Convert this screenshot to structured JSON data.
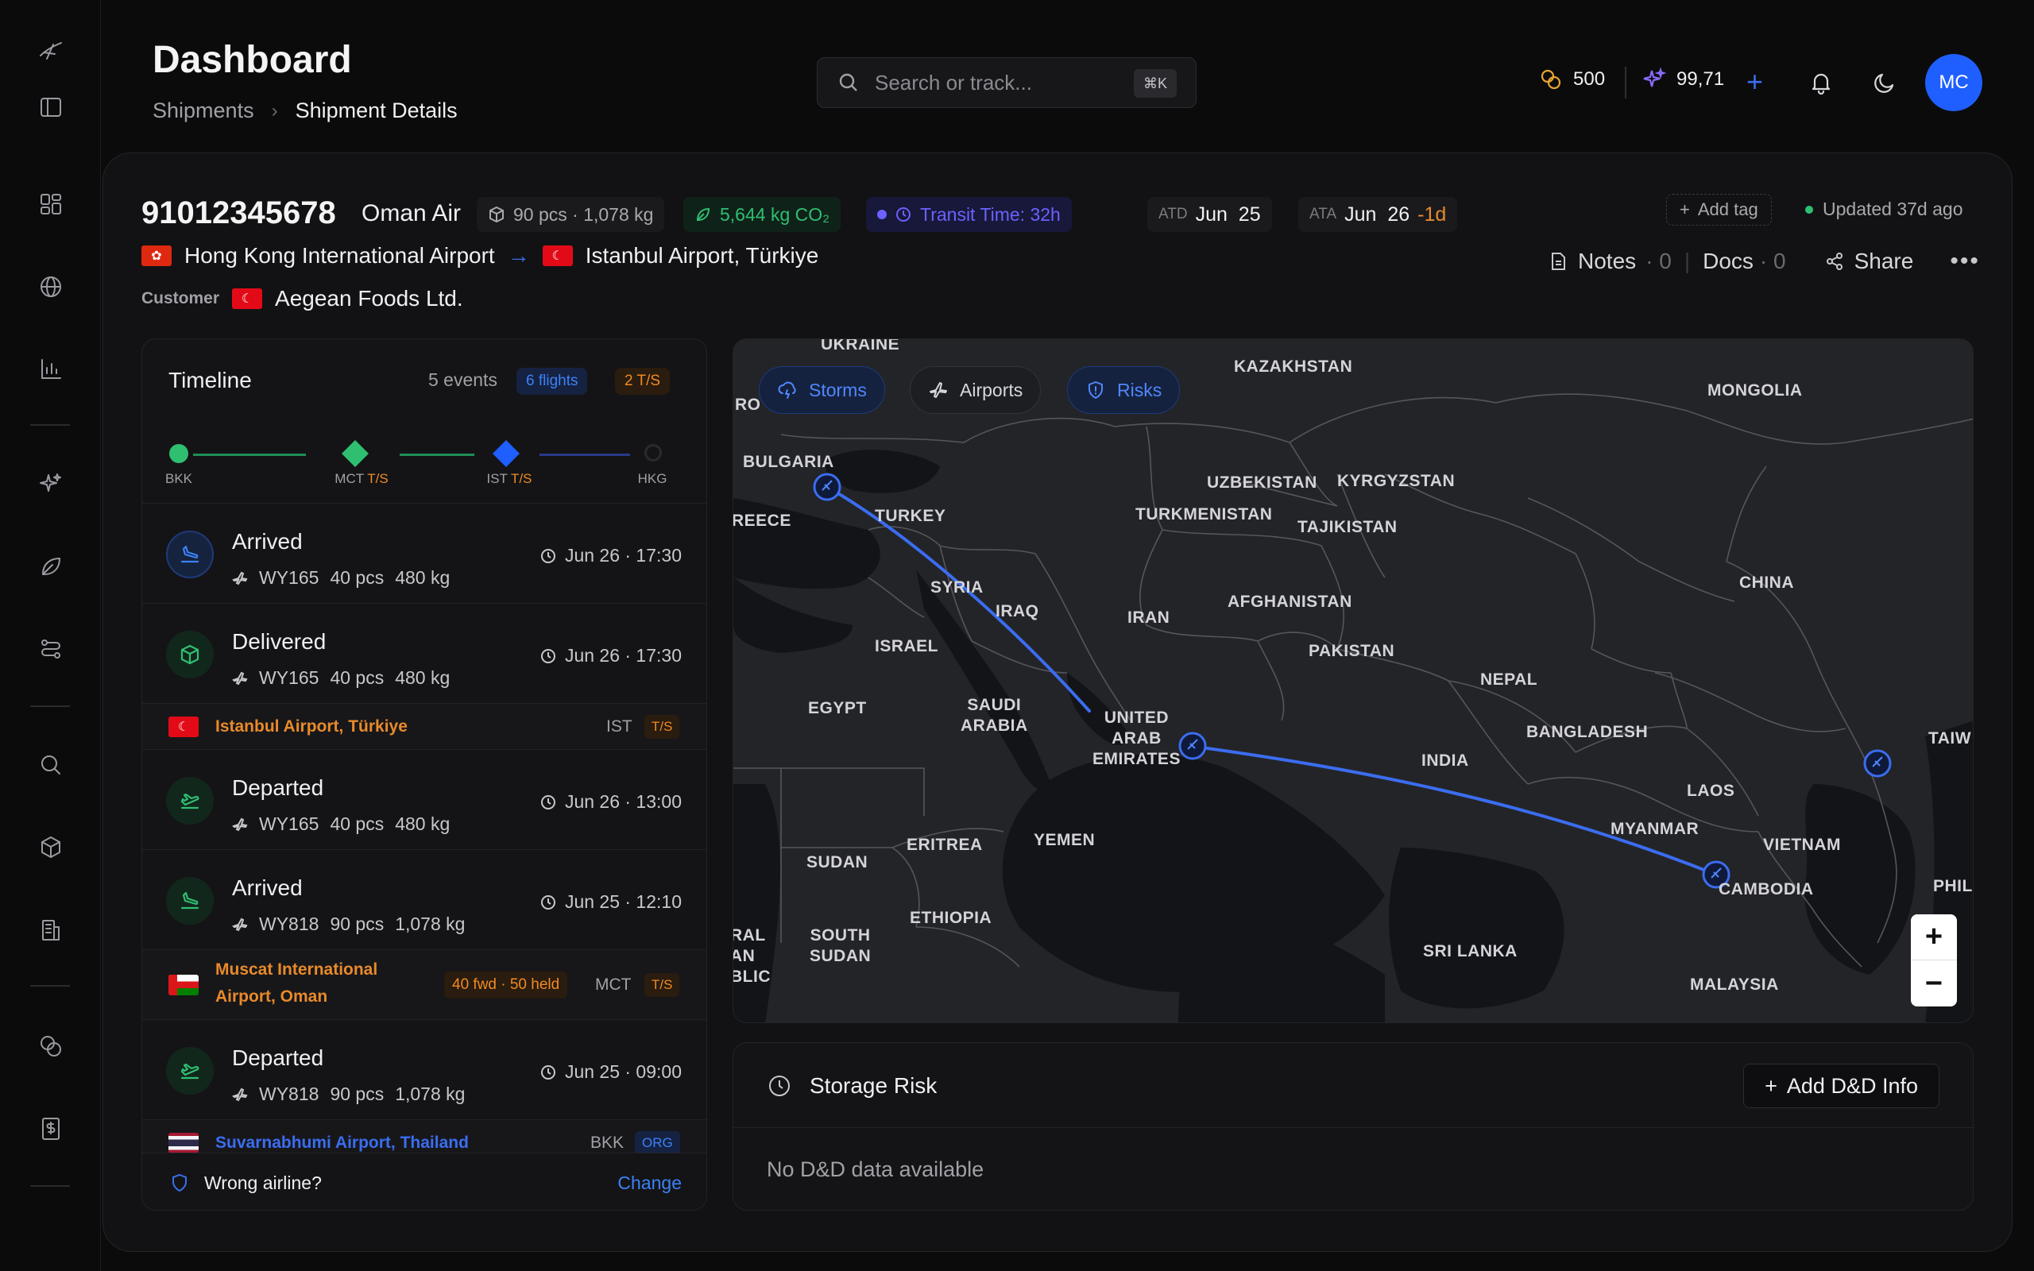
{
  "header": {
    "title": "Dashboard",
    "breadcrumbs": [
      "Shipments",
      "Shipment Details"
    ],
    "search_placeholder": "Search or track...",
    "search_shortcut": "⌘K",
    "credits_value": "500",
    "points_value": "99,71"
  },
  "avatar_initials": "MC",
  "shipment": {
    "id": "91012345678",
    "airline": "Oman Air",
    "pcs_weight": "90 pcs · 1,078 kg",
    "co2": "5,644 kg CO₂",
    "transit": "Transit Time: 32h",
    "atd_label": "ATD",
    "atd_value": "Jun  25",
    "ata_label": "ATA",
    "ata_value": "Jun  26",
    "ata_delay": "-1d",
    "add_tag": "Add tag",
    "updated": "Updated 37d ago",
    "origin": "Hong Kong International Airport",
    "destination": "Istanbul Airport, Türkiye",
    "customer_label": "Customer",
    "customer_name": "Aegean Foods Ltd.",
    "notes_label": "Notes",
    "notes_count": "· 0",
    "docs_label": "Docs",
    "docs_count": "· 0",
    "share_label": "Share"
  },
  "timeline": {
    "title": "Timeline",
    "events_count": "5 events",
    "flights_badge": "6 flights",
    "ts_badge": "2 T/S",
    "stops": [
      {
        "code": "BKK",
        "ts": ""
      },
      {
        "code": "MCT",
        "ts": "T/S"
      },
      {
        "code": "IST",
        "ts": "T/S"
      },
      {
        "code": "HKG",
        "ts": ""
      }
    ],
    "events": [
      {
        "title": "Arrived",
        "flight": "WY165",
        "pcs": "40 pcs",
        "kg": "480 kg",
        "time": "Jun 26 · 17:30"
      },
      {
        "title": "Delivered",
        "flight": "WY165",
        "pcs": "40 pcs",
        "kg": "480 kg",
        "time": "Jun 26 · 17:30"
      },
      {
        "title": "Departed",
        "flight": "WY165",
        "pcs": "40 pcs",
        "kg": "480 kg",
        "time": "Jun 26 · 13:00"
      },
      {
        "title": "Arrived",
        "flight": "WY818",
        "pcs": "90 pcs",
        "kg": "1,078 kg",
        "time": "Jun 25 · 12:10"
      },
      {
        "title": "Departed",
        "flight": "WY818",
        "pcs": "90 pcs",
        "kg": "1,078 kg",
        "time": "Jun 25 · 09:00"
      }
    ],
    "locations": [
      {
        "name": "Istanbul Airport, Türkiye",
        "code": "IST",
        "tag": "T/S"
      },
      {
        "name_line1": "Muscat International",
        "name_line2": "Airport, Oman",
        "held": "40 fwd · 50 held",
        "code": "MCT",
        "tag": "T/S"
      },
      {
        "name": "Suvarnabhumi Airport, Thailand",
        "code": "BKK",
        "tag": "ORG"
      }
    ],
    "footer_text": "Wrong airline?",
    "footer_action": "Change"
  },
  "map": {
    "buttons": {
      "storms": "Storms",
      "airports": "Airports",
      "risks": "Risks"
    },
    "countries": {
      "ukraine": "UKRAINE",
      "kazakhstan": "KAZAKHSTAN",
      "mongolia": "MONGOLIA",
      "ro": "RO",
      "bulgaria": "BULGARIA",
      "uzbekistan": "UZBEKISTAN",
      "kyrgyzstan": "KYRGYZSTAN",
      "greece": "REECE",
      "turkey": "TURKEY",
      "turkmenistan": "TURKMENISTAN",
      "tajikistan": "TAJIKISTAN",
      "china": "CHINA",
      "syria": "SYRIA",
      "iraq": "IRAQ",
      "iran": "IRAN",
      "afghanistan": "AFGHANISTAN",
      "israel": "ISRAEL",
      "pakistan": "PAKISTAN",
      "nepal": "NEPAL",
      "egypt": "EGYPT",
      "saudi": "SAUDI\nARABIA",
      "uae": "UNITED\nARAB\nEMIRATES",
      "bangladesh": "BANGLADESH",
      "india": "INDIA",
      "taiwan": "TAIW",
      "laos": "LAOS",
      "myanmar": "MYANMAR",
      "eritrea": "ERITREA",
      "yemen": "YEMEN",
      "vietnam": "VIETNAM",
      "sudan": "SUDAN",
      "cambodia": "CAMBODIA",
      "phil": "PHIL",
      "ethiopia": "ETHIOPIA",
      "car": "RAL\nAN\nBLIC",
      "south_sudan": "SOUTH\nSUDAN",
      "sri_lanka": "SRI LANKA",
      "malaysia": "MALAYSIA"
    },
    "zoom_in": "+",
    "zoom_out": "−"
  },
  "storage_risk": {
    "title": "Storage Risk",
    "add_button": "Add D&D Info",
    "empty": "No D&D data available"
  },
  "colors": {
    "accent_blue": "#3b6df0",
    "orange": "#f08a24",
    "green": "#2fbf71",
    "purple": "#6b62ff"
  }
}
